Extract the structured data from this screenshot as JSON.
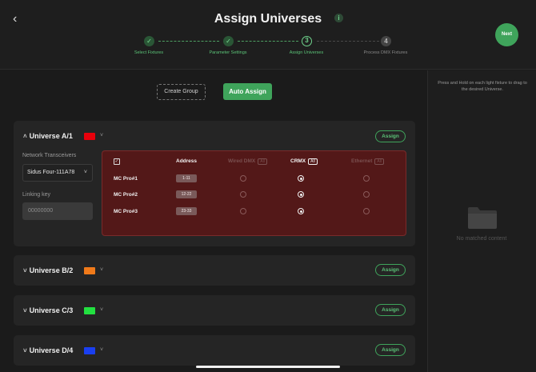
{
  "header": {
    "back_glyph": "‹",
    "title": "Assign Universes",
    "info_glyph": "i",
    "next_label": "Next"
  },
  "stepper": [
    {
      "label": "Select Fixtures",
      "state": "done",
      "marker": "✓"
    },
    {
      "label": "Parameter Settings",
      "state": "done",
      "marker": "✓"
    },
    {
      "label": "Assign Universes",
      "state": "current",
      "marker": "3"
    },
    {
      "label": "Process DMX Fixtures",
      "state": "todo",
      "marker": "4"
    }
  ],
  "actions": {
    "create_group": "Create Group",
    "auto_assign": "Auto Assign"
  },
  "right_panel": {
    "hint": "Press and Hold on each light fixture to drag to the desired Universe.",
    "empty_text": "No matched content"
  },
  "universes": [
    {
      "name": "Universe A/1",
      "color": "#e8000b",
      "assign": "Assign",
      "expanded": true
    },
    {
      "name": "Universe B/2",
      "color": "#f07a1a",
      "assign": "Assign",
      "expanded": false
    },
    {
      "name": "Universe C/3",
      "color": "#22e040",
      "assign": "Assign",
      "expanded": false
    },
    {
      "name": "Universe D/4",
      "color": "#1a3ff0",
      "assign": "Assign",
      "expanded": false
    }
  ],
  "universe_a": {
    "network_label": "Network Transceivers",
    "network_value": "Sidus Four-111A78",
    "linking_label": "Linking key",
    "linking_placeholder": "00000000",
    "columns": {
      "address": "Address",
      "wired": "Wired DMX",
      "crmx": "CRMX",
      "ethernet": "Ethernet",
      "all": "All"
    },
    "fixtures": [
      {
        "name": "MC Pro#1",
        "address": "1-11",
        "protocol": "CRMX"
      },
      {
        "name": "MC Pro#2",
        "address": "12-22",
        "protocol": "CRMX"
      },
      {
        "name": "MC Pro#3",
        "address": "23-33",
        "protocol": "CRMX"
      }
    ]
  },
  "colors": {
    "accent": "#3fa45b",
    "panel": "#531818"
  }
}
